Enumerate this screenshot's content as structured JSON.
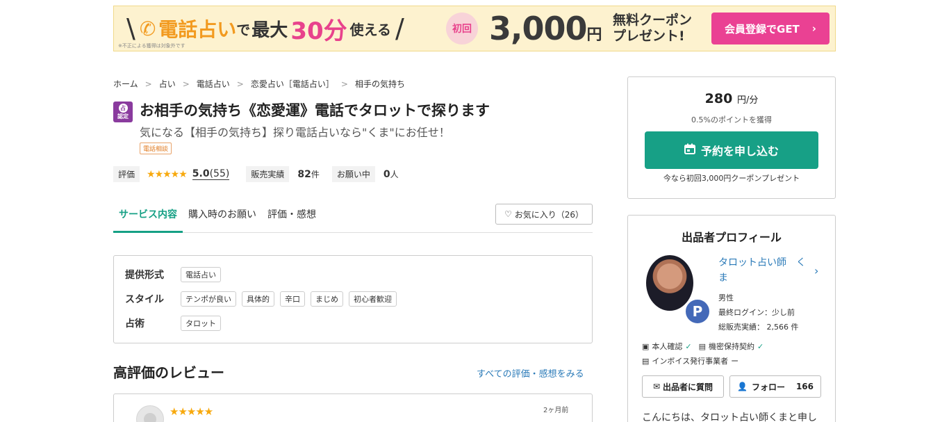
{
  "banner": {
    "slash_left": "\\",
    "phone_word": "電話占い",
    "de": "で",
    "saidai": "最大",
    "minutes": "30分",
    "tsukaeru": "使える",
    "slash_right": "/",
    "shokai": "初回",
    "amount": "3,000",
    "yen": "円",
    "coupon_line1": "無料クーポン",
    "coupon_line2": "プレゼント!",
    "cta_label": "会員登録でGET",
    "note": "※不正による獲得は対象外です"
  },
  "breadcrumb": [
    "ホーム",
    "占い",
    "電話占い",
    "恋愛占い［電話占い］",
    "相手の気持ち"
  ],
  "service": {
    "badge_top": "占",
    "badge_bottom": "認定",
    "title": "お相手の気持ち《恋愛運》電話でタロットで探ります",
    "subtitle": "気になる【相手の気持ち】探り電話占いなら\"くま\"にお任せ！",
    "tag": "電話相談"
  },
  "stats": {
    "rating_label": "評価",
    "rating_stars": 5,
    "rating_value": "5.0",
    "rating_count": "(55)",
    "sales_label": "販売実績",
    "sales_value": "82",
    "sales_unit": "件",
    "requests_label": "お願い中",
    "requests_value": "0",
    "requests_unit": "人"
  },
  "tabs": [
    {
      "label": "サービス内容",
      "active": true
    },
    {
      "label": "購入時のお願い",
      "active": false
    },
    {
      "label": "評価・感想",
      "active": false
    }
  ],
  "favorite": {
    "label": "お気に入り（26）"
  },
  "details": {
    "format_label": "提供形式",
    "format_tags": [
      "電話占い"
    ],
    "style_label": "スタイル",
    "style_tags": [
      "テンポが良い",
      "具体的",
      "辛口",
      "まじめ",
      "初心者歓迎"
    ],
    "method_label": "占術",
    "method_tags": [
      "タロット"
    ]
  },
  "reviews": {
    "title": "高評価のレビュー",
    "see_all": "すべての評価・感想をみる",
    "first_stars": 5,
    "first_date": "2ヶ月前"
  },
  "pricing": {
    "price": "280",
    "unit": "円/分",
    "points": "0.5%のポイントを獲得",
    "reserve_label": "予約を申し込む",
    "coupon_note": "今なら初回3,000円クーポンプレゼント"
  },
  "profile": {
    "title": "出品者プロフィール",
    "name": "タロット占い師　くま",
    "gender": "男性",
    "last_login": "最終ログイン：少し前",
    "total_sales": "総販売実績： 2,566 件",
    "identity": "本人確認",
    "nda": "機密保持契約",
    "invoice": "インボイス発行事業者",
    "invoice_status": "ー",
    "ask_label": "出品者に質問",
    "follow_label": "フォロー",
    "follow_count": "166",
    "intro": "こんにちは、タロット占い師くまと申し"
  },
  "colors": {
    "accent": "#17a086",
    "cta_pink": "#ea4193",
    "star": "#f7a90e",
    "link": "#2a7ab8"
  }
}
